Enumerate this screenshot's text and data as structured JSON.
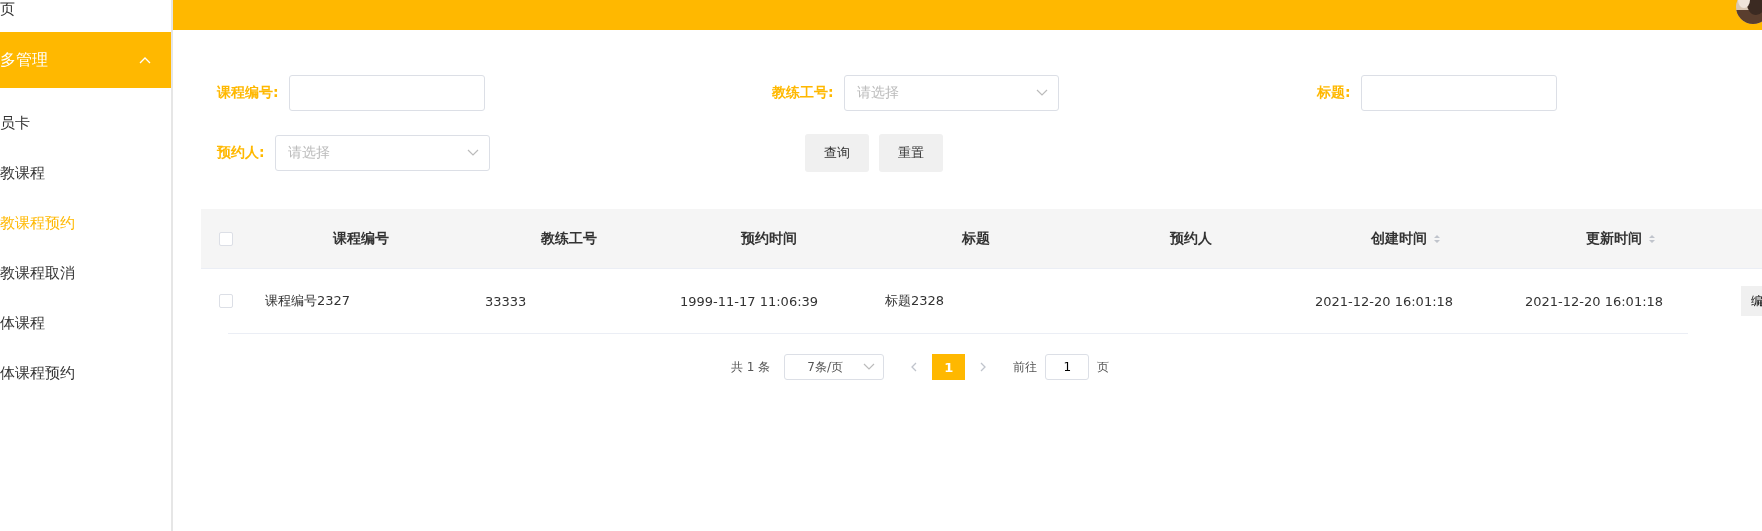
{
  "sidebar": {
    "items": [
      {
        "label": "页",
        "selected": false,
        "kind": "link"
      },
      {
        "label": "多管理",
        "selected": false,
        "kind": "group",
        "expanded": true
      },
      {
        "label": "员卡",
        "selected": false,
        "kind": "link"
      },
      {
        "label": "教课程",
        "selected": false,
        "kind": "link"
      },
      {
        "label": "教课程预约",
        "selected": true,
        "kind": "link"
      },
      {
        "label": "教课程取消",
        "selected": false,
        "kind": "link"
      },
      {
        "label": "体课程",
        "selected": false,
        "kind": "link"
      },
      {
        "label": "体课程预约",
        "selected": false,
        "kind": "link"
      }
    ]
  },
  "search": {
    "fields": [
      {
        "label": "课程编号:",
        "kind": "input"
      },
      {
        "label": "教练工号:",
        "kind": "select",
        "placeholder": "请选择"
      },
      {
        "label": "标题:",
        "kind": "input"
      },
      {
        "label": "预约人:",
        "kind": "select",
        "placeholder": "请选择"
      }
    ],
    "buttons": [
      "查询",
      "重置"
    ]
  },
  "table": {
    "all_checked": false,
    "columns": [
      {
        "label": "课程编号",
        "sortable": false
      },
      {
        "label": "教练工号",
        "sortable": false
      },
      {
        "label": "预约时间",
        "sortable": false
      },
      {
        "label": "标题",
        "sortable": false
      },
      {
        "label": "预约人",
        "sortable": false
      },
      {
        "label": "创建时间",
        "sortable": true
      },
      {
        "label": "更新时间",
        "sortable": true
      }
    ],
    "rows": [
      {
        "checked": false,
        "cells": [
          "课程编号2327",
          "33333",
          "1999-11-17 11:06:39",
          "标题2328",
          "",
          "2021-12-20 16:01:18",
          "2021-12-20 16:01:18"
        ],
        "action": "编"
      }
    ]
  },
  "pagination": {
    "total": "共 1 条",
    "page_size": "7条/页",
    "pages": [
      {
        "label": "1",
        "selected": true
      }
    ],
    "goto_label": "前往",
    "goto_value": "1",
    "goto_suffix": "页"
  }
}
